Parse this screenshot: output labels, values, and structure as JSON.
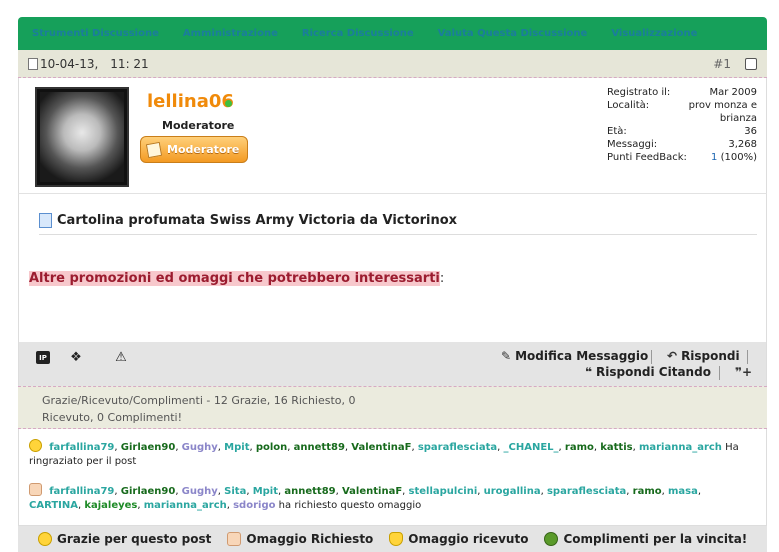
{
  "toolbar": {
    "items": [
      "Strumenti Discussione",
      "Amministrazione",
      "Ricerca Discussione",
      "Valuta Questa Discussione",
      "Visualizzazione"
    ]
  },
  "post_header": {
    "date": "10-04-13,",
    "time": "11: 21",
    "post_number": "#1"
  },
  "user": {
    "name": "lellina06",
    "role": "Moderatore",
    "badge": "Moderatore",
    "stats": [
      {
        "label": "Registrato il:",
        "value": "Mar 2009"
      },
      {
        "label": "Località:",
        "value": "prov monza e brianza"
      },
      {
        "label": "Età:",
        "value": "36"
      },
      {
        "label": "Messaggi:",
        "value": "3,268"
      }
    ],
    "feedback_label": "Punti FeedBack:",
    "feedback_count": "1",
    "feedback_pct": "(100%)"
  },
  "post": {
    "title": "Cartolina profumata Swiss Army Victoria da Victorinox",
    "promo_text": "Altre promozioni ed omaggi che potrebbero interessarti",
    "promo_suffix": ":"
  },
  "actions": {
    "edit": "Modifica Messaggio",
    "reply": "Rispondi",
    "quote": "Rispondi Citando"
  },
  "thanks": {
    "summary_line1": "Grazie/Ricevuto/Complimenti - 12 Grazie, 16 Richiesto, 0",
    "summary_line2": "Ricevuto, 0 Complimenti!",
    "thanked_users": [
      {
        "name": "farfallina79",
        "color": "#2aa6a0"
      },
      {
        "name": "Girlaen90",
        "color": "#176a1c"
      },
      {
        "name": "Gughy",
        "color": "#8b86c9"
      },
      {
        "name": "Mpit",
        "color": "#2aa6a0"
      },
      {
        "name": "polon",
        "color": "#176a1c"
      },
      {
        "name": "annett89",
        "color": "#176a1c"
      },
      {
        "name": "ValentinaF",
        "color": "#176a1c"
      },
      {
        "name": "sparaflesciata",
        "color": "#2aa6a0"
      },
      {
        "name": "_CHANEL_",
        "color": "#2aa6a0"
      },
      {
        "name": "ramo",
        "color": "#176a1c"
      },
      {
        "name": "kattis",
        "color": "#176a1c"
      },
      {
        "name": "marianna_arch",
        "color": "#2aa6a0"
      }
    ],
    "thanked_suffix": "Ha ringraziato per il post",
    "requested_users": [
      {
        "name": "farfallina79",
        "color": "#2aa6a0"
      },
      {
        "name": "Girlaen90",
        "color": "#176a1c"
      },
      {
        "name": "Gughy",
        "color": "#8b86c9"
      },
      {
        "name": "Sita",
        "color": "#2aa6a0"
      },
      {
        "name": "Mpit",
        "color": "#2aa6a0"
      },
      {
        "name": "annett89",
        "color": "#176a1c"
      },
      {
        "name": "ValentinaF",
        "color": "#176a1c"
      },
      {
        "name": "stellapulcini",
        "color": "#2aa6a0"
      },
      {
        "name": "urogallina",
        "color": "#2aa6a0"
      },
      {
        "name": "sparaflesciata",
        "color": "#2aa6a0"
      },
      {
        "name": "ramo",
        "color": "#176a1c"
      },
      {
        "name": "masa",
        "color": "#2aa6a0"
      },
      {
        "name": "CARTINA",
        "color": "#2aa6a0"
      },
      {
        "name": "kajaleyes",
        "color": "#1d8a26"
      },
      {
        "name": "marianna_arch",
        "color": "#2aa6a0"
      },
      {
        "name": "sdorigo",
        "color": "#8b86c9"
      }
    ],
    "requested_suffix": "ha richiesto questo omaggio"
  },
  "bottom_actions": {
    "thanks": "Grazie per questo post",
    "requested": "Omaggio Richiesto",
    "received": "Omaggio ricevuto",
    "compliments": "Complimenti per la vincita!"
  },
  "colors": {
    "toolbar_bg": "#16a05a",
    "toolbar_link": "#1b7d9c",
    "username": "#f08a0a",
    "promo_highlight": "#f7c8cc"
  }
}
